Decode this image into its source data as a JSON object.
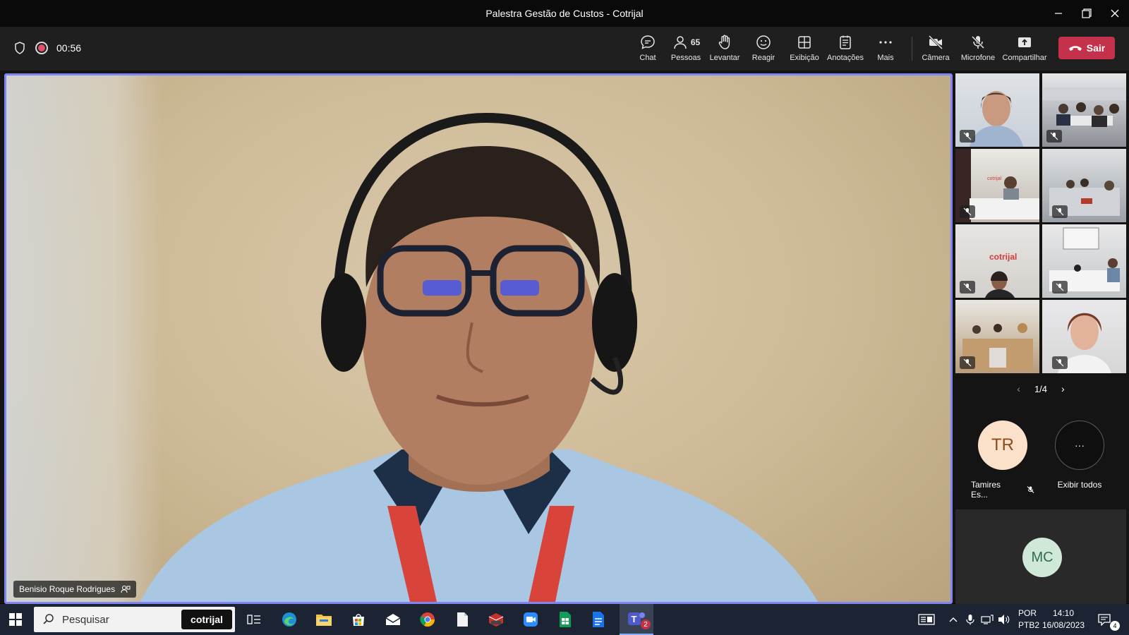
{
  "window": {
    "title": "Palestra Gestão de Custos - Cotrijal"
  },
  "meeting": {
    "timer": "00:56",
    "toolbar": {
      "chat": "Chat",
      "people_count": "65",
      "people": "Pessoas",
      "raise": "Levantar",
      "react": "Reagir",
      "view": "Exibição",
      "notes": "Anotações",
      "more": "Mais",
      "camera": "Câmera",
      "microphone": "Microfone",
      "share": "Compartilhar",
      "leave": "Sair"
    },
    "speaker": {
      "name": "Benisio Roque Rodrigues"
    },
    "gallery": {
      "page": "1/4"
    },
    "participants": [
      {
        "initials": "TR",
        "name": "Tamires Es..."
      },
      {
        "initials": "···",
        "name": "Exibir todos"
      }
    ],
    "extra_participant": {
      "initials": "MC"
    },
    "brand_text": "cotrijal"
  },
  "taskbar": {
    "search_placeholder": "Pesquisar",
    "search_brand": "cotrijal",
    "teams_badge": "2",
    "language": "POR",
    "layout": "PTB2",
    "time": "14:10",
    "date": "16/08/2023",
    "notifications": "4"
  },
  "colors": {
    "accent": "#7f85f5",
    "leave": "#c4314b",
    "record": "#e05068",
    "taskbar": "#1c2333"
  }
}
